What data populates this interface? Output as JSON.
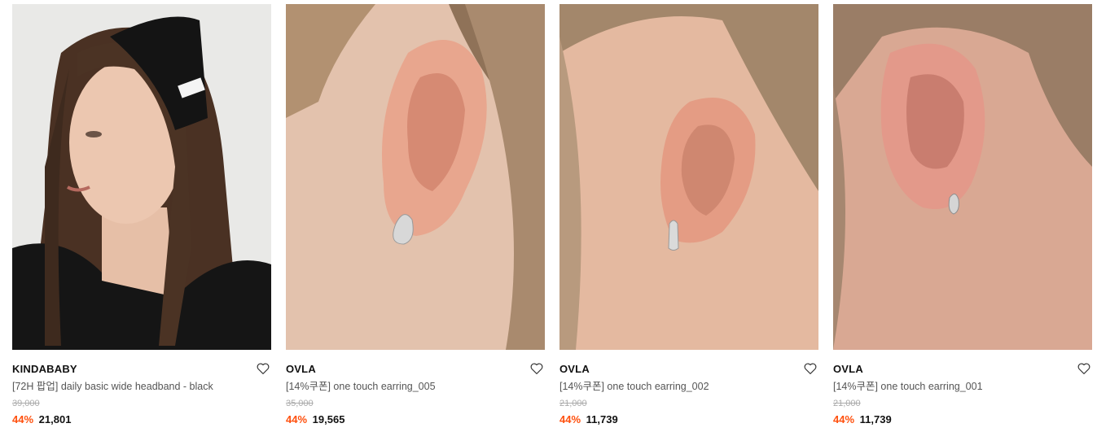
{
  "products": [
    {
      "brand": "KINDABABY",
      "name": "[72H 팝업] daily basic wide headband - black",
      "original_price": "39,000",
      "discount": "44%",
      "price": "21,801",
      "image_icon": "headband-model-photo"
    },
    {
      "brand": "OVLA",
      "name": "[14%쿠폰] one touch earring_005",
      "original_price": "35,000",
      "discount": "44%",
      "price": "19,565",
      "image_icon": "ear-earring-photo"
    },
    {
      "brand": "OVLA",
      "name": "[14%쿠폰] one touch earring_002",
      "original_price": "21,000",
      "discount": "44%",
      "price": "11,739",
      "image_icon": "ear-earring-photo"
    },
    {
      "brand": "OVLA",
      "name": "[14%쿠폰] one touch earring_001",
      "original_price": "21,000",
      "discount": "44%",
      "price": "11,739",
      "image_icon": "ear-earring-photo"
    }
  ],
  "colors": {
    "discount": "#ff4f0c",
    "brand": "#111111",
    "name": "#555555",
    "original_price": "#aaaaaa"
  }
}
